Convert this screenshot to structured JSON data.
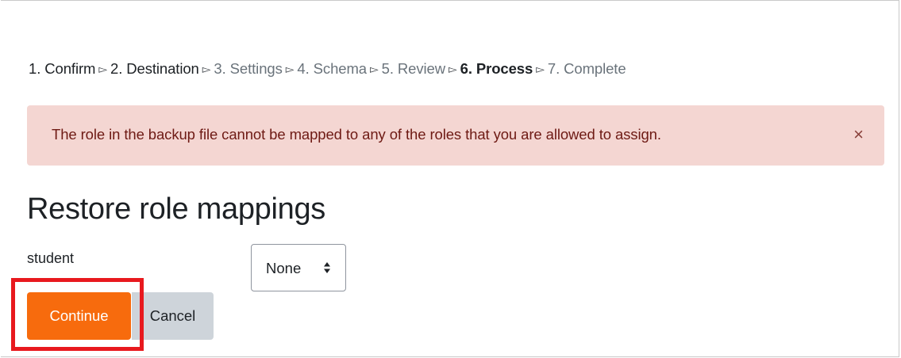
{
  "steps": [
    {
      "label": "1. Confirm",
      "state": "done"
    },
    {
      "label": "2. Destination",
      "state": "done"
    },
    {
      "label": "3. Settings",
      "state": "todo"
    },
    {
      "label": "4. Schema",
      "state": "todo"
    },
    {
      "label": "5. Review",
      "state": "todo"
    },
    {
      "label": "6. Process",
      "state": "current"
    },
    {
      "label": "7. Complete",
      "state": "todo"
    }
  ],
  "step_separator": "⭢",
  "alert": {
    "message": "The role in the backup file cannot be mapped to any of the roles that you are allowed to assign.",
    "close_glyph": "×",
    "close_icon": "close-icon",
    "color": "#f4d6d2"
  },
  "heading": "Restore role mappings",
  "role_mapping": {
    "label": "student",
    "selected": "None",
    "caret_icon": "sort-caret-icon"
  },
  "buttons": {
    "continue_label": "Continue",
    "cancel_label": "Cancel",
    "primary_color": "#f76b0d"
  },
  "highlight_color": "#e8191e"
}
